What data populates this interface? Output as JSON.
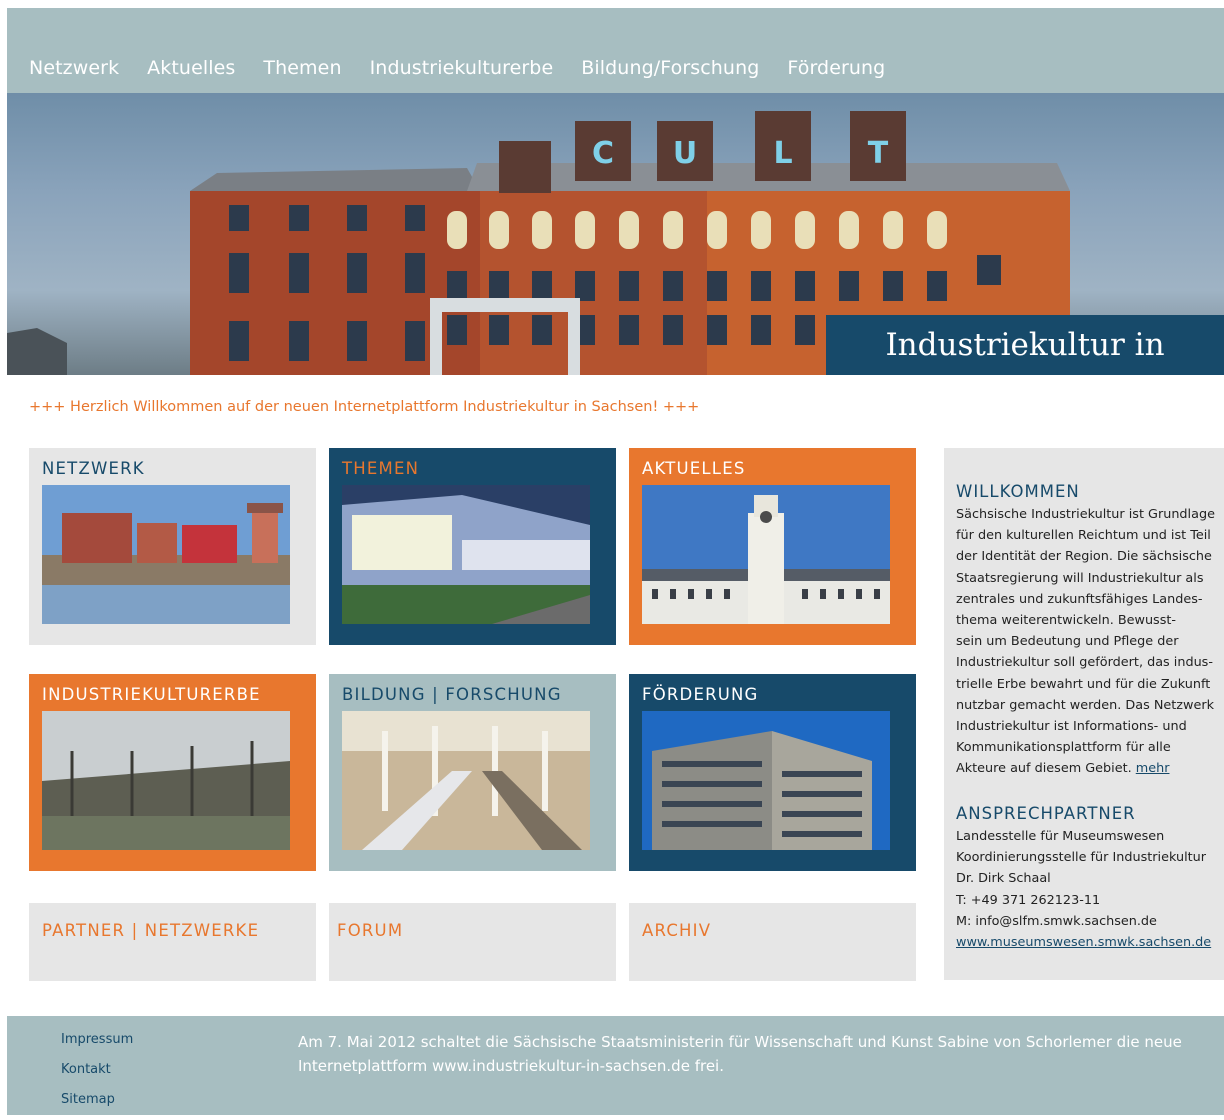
{
  "nav": {
    "items": [
      "Netzwerk",
      "Aktuelles",
      "Themen",
      "Industriekulturerbe",
      "Bildung/Forschung",
      "Förderung"
    ]
  },
  "hero": {
    "title": "Industriekultur in Sachsen",
    "sign_letters": [
      "C",
      "U",
      "L",
      "T"
    ]
  },
  "ticker": "+++ Herzlich Willkommen auf der neuen Internetplattform Industriekultur in Sachsen! +++",
  "tiles": [
    {
      "label": "NETZWERK"
    },
    {
      "label": "THEMEN"
    },
    {
      "label": "AKTUELLES"
    },
    {
      "label": "INDUSTRIEKULTURERBE"
    },
    {
      "label": "BILDUNG | FORSCHUNG"
    },
    {
      "label": "FÖRDERUNG"
    }
  ],
  "small_tiles": [
    {
      "label": "PARTNER | NETZWERKE"
    },
    {
      "label": "FORUM"
    },
    {
      "label": "ARCHIV"
    }
  ],
  "sidebar": {
    "welcome_title": "WILLKOMMEN",
    "welcome_lines": [
      "Sächsische Industriekultur ist Grundlage",
      "für den kulturellen Reichtum und ist Teil",
      "der Identität der Region. Die sächsische",
      "Staatsregierung will Industriekultur als",
      "zentrales und zukunftsfähiges Landes-",
      "thema weiterentwickeln. Bewusst-",
      "sein um Bedeutung und Pflege der",
      "Industriekultur soll gefördert, das indus-",
      "trielle Erbe bewahrt und für die Zukunft",
      "nutzbar gemacht werden. Das Netzwerk",
      "Industriekultur ist Informations- und",
      "Kommunikationsplattform für alle",
      "Akteure auf diesem Gebiet."
    ],
    "more_link": "mehr",
    "contact_title": "ANSPRECHPARTNER",
    "contact_lines": [
      "Landesstelle für Museumswesen",
      "Koordinierungsstelle für Industriekultur",
      "Dr. Dirk Schaal",
      "T:  +49 371 262123-11",
      "M: info@slfm.smwk.sachsen.de"
    ],
    "contact_link": "www.museumswesen.smwk.sachsen.de"
  },
  "footer": {
    "links": [
      "Impressum",
      "Kontakt",
      "Sitemap"
    ],
    "note": "Am 7. Mai 2012 schaltet die Sächsische Staatsministerin für Wissenschaft und Kunst Sabine von Schorlemer die neue Internetplattform www.industriekultur-in-sachsen.de frei."
  },
  "colors": {
    "navy": "#174a6a",
    "orange": "#e8772e",
    "teal_grey": "#a7bec1",
    "light_grey": "#e6e6e6"
  }
}
